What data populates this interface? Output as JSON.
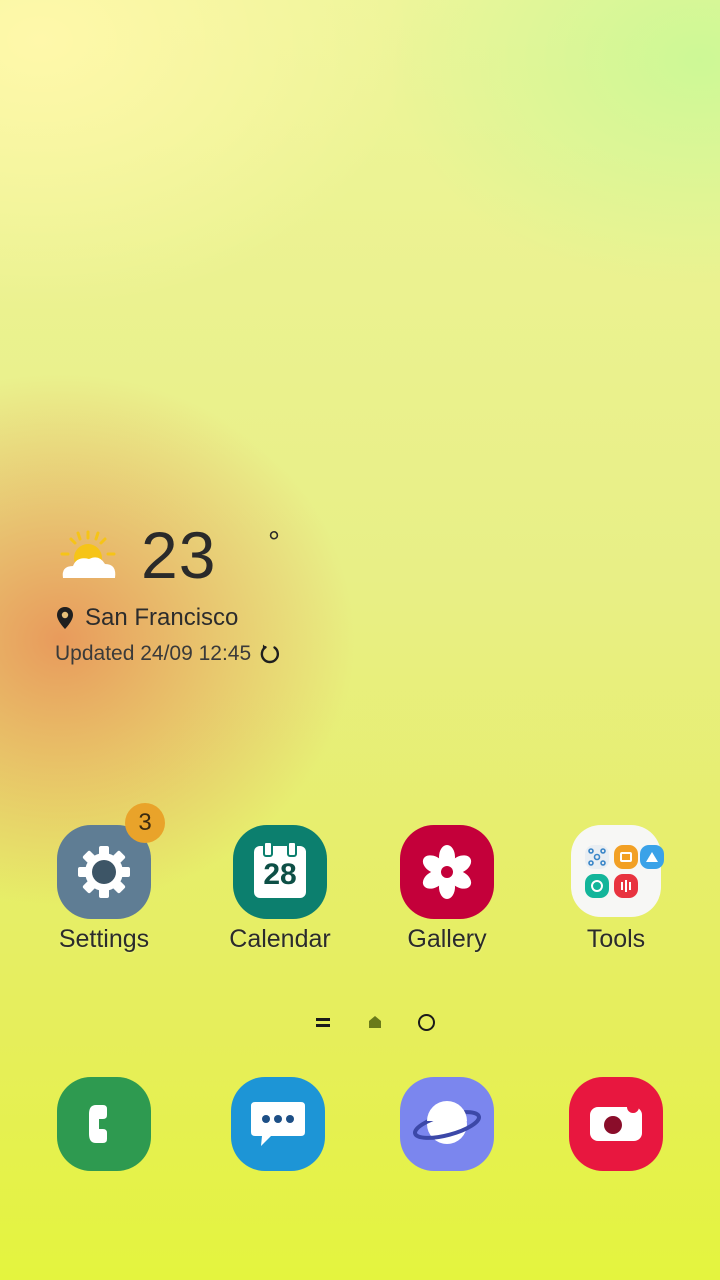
{
  "weather": {
    "temperature": "23",
    "degree_symbol": "°",
    "location": "San Francisco",
    "updated": "Updated 24/09 12:45",
    "icon": "partly-sunny-icon"
  },
  "apps": [
    {
      "label": "Settings",
      "icon": "gear-icon",
      "color": "#5f7d94",
      "badge": "3"
    },
    {
      "label": "Calendar",
      "icon": "calendar-icon",
      "color": "#0c7f6e",
      "day": "28"
    },
    {
      "label": "Gallery",
      "icon": "flower-icon",
      "color": "#c4003a"
    },
    {
      "label": "Tools",
      "icon": "folder-icon",
      "color": "#f7f7f5"
    }
  ],
  "page_indicator": {
    "items": [
      "menu-icon",
      "home-icon",
      "page-dot-icon"
    ]
  },
  "dock": [
    {
      "name": "phone",
      "icon": "phone-icon",
      "color": "#2e9a50"
    },
    {
      "name": "messages",
      "icon": "chat-bubble-icon",
      "color": "#1d95d6"
    },
    {
      "name": "internet",
      "icon": "planet-icon",
      "color": "#7b86ee"
    },
    {
      "name": "camera",
      "icon": "camera-icon",
      "color": "#e8173f"
    }
  ]
}
